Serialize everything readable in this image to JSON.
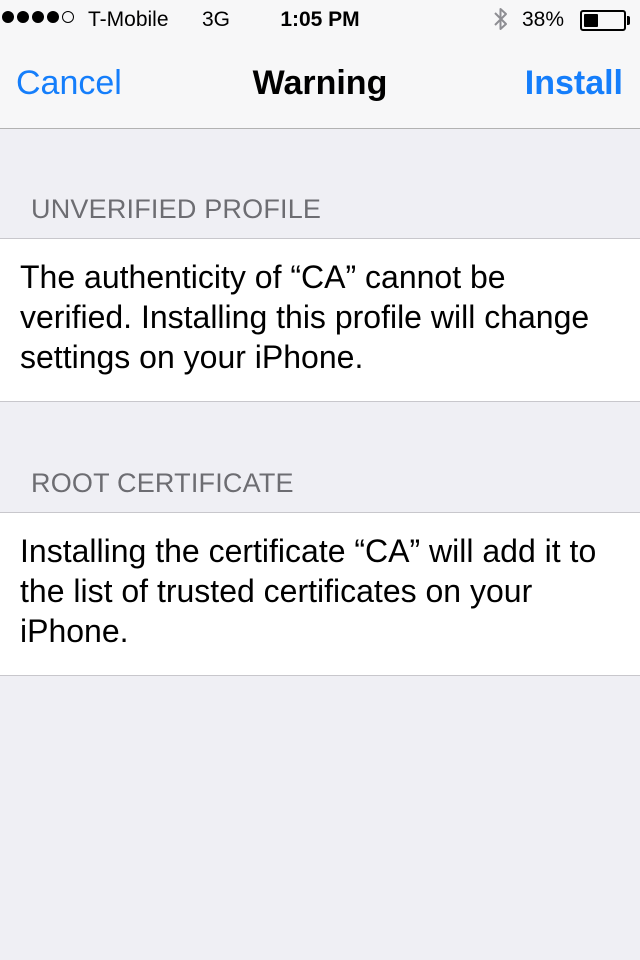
{
  "status_bar": {
    "carrier": "T-Mobile",
    "network": "3G",
    "time": "1:05 PM",
    "battery_percent": "38%",
    "battery_level": 0.38,
    "signal_bars_filled": 4,
    "signal_bars_total": 5
  },
  "nav": {
    "cancel_label": "Cancel",
    "title": "Warning",
    "install_label": "Install"
  },
  "sections": [
    {
      "header": "UNVERIFIED PROFILE",
      "body": "The authenticity of “CA” cannot be verified. Installing this profile will change settings on your iPhone."
    },
    {
      "header": "ROOT CERTIFICATE",
      "body": "Installing the certificate “CA” will add it to the list of trusted certificates on your iPhone."
    }
  ],
  "colors": {
    "accent": "#157efb",
    "background": "#efeff4",
    "section_header": "#6d6d72"
  }
}
